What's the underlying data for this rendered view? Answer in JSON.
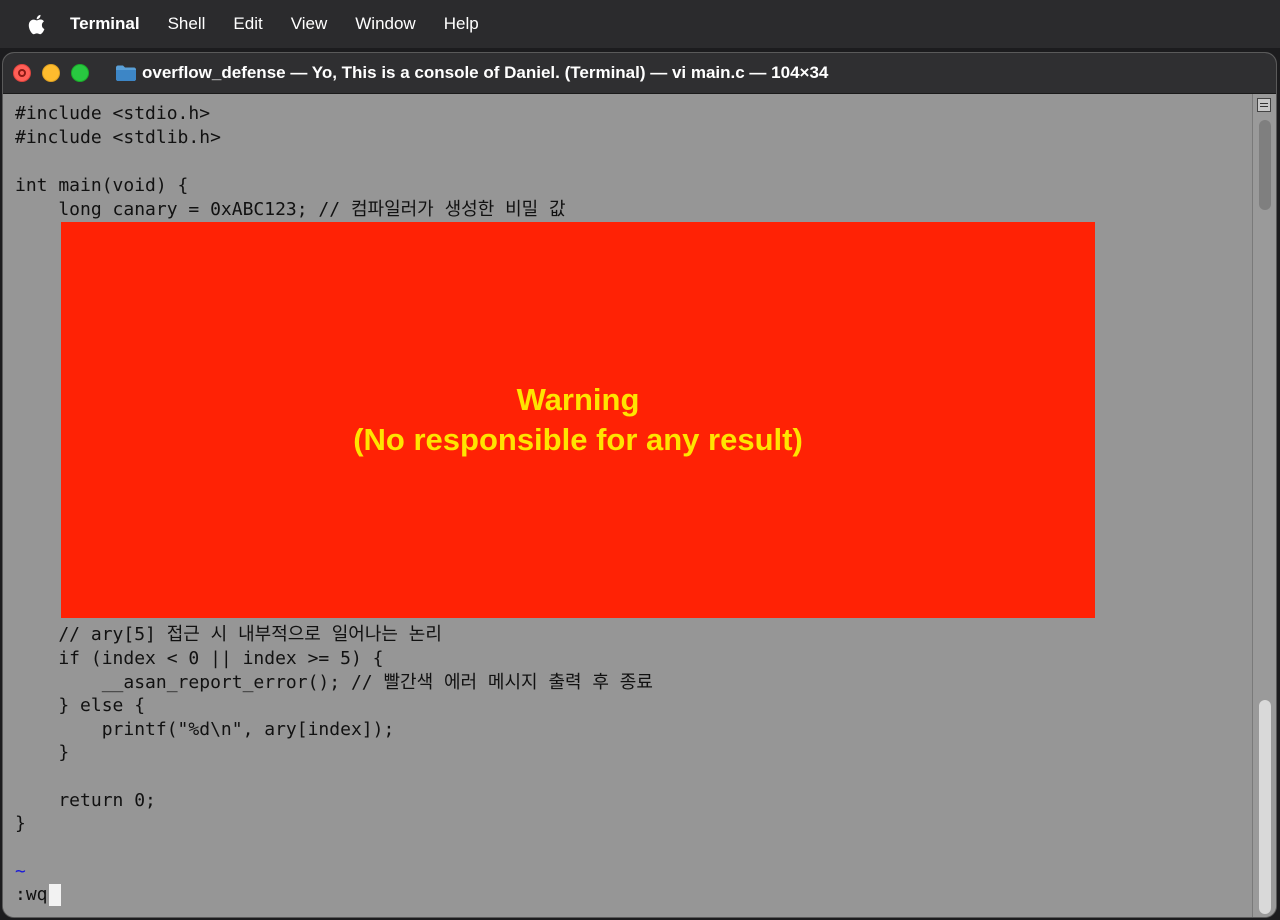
{
  "menubar": {
    "apple_icon": "apple-logo",
    "items": [
      "Terminal",
      "Shell",
      "Edit",
      "View",
      "Window",
      "Help"
    ]
  },
  "window": {
    "title": "overflow_defense — Yo, This is a console of Daniel. (Terminal) — vi main.c — 104×34"
  },
  "editor": {
    "lines": [
      "#include <stdio.h>",
      "#include <stdlib.h>",
      "",
      "int main(void) {",
      "    long canary = 0xABC123; // 컴파일러가 생성한 비밀 값",
      "    // ary[5] 접근 시 내부적으로 일어나는 논리",
      "    if (index < 0 || index >= 5) {",
      "        __asan_report_error(); // 빨간색 에러 메시지 출력 후 종료",
      "    } else {",
      "        printf(\"%d\\n\", ary[index]);",
      "    }",
      "",
      "    return 0;",
      "}",
      "~"
    ],
    "command": ":wq"
  },
  "warning": {
    "line1": "Warning",
    "line2": "(No responsible for any result)"
  },
  "colors": {
    "terminal_bg": "#969696",
    "warning_bg": "#ff2205",
    "warning_text": "#ffe400",
    "tilde": "#1a1ad8"
  }
}
